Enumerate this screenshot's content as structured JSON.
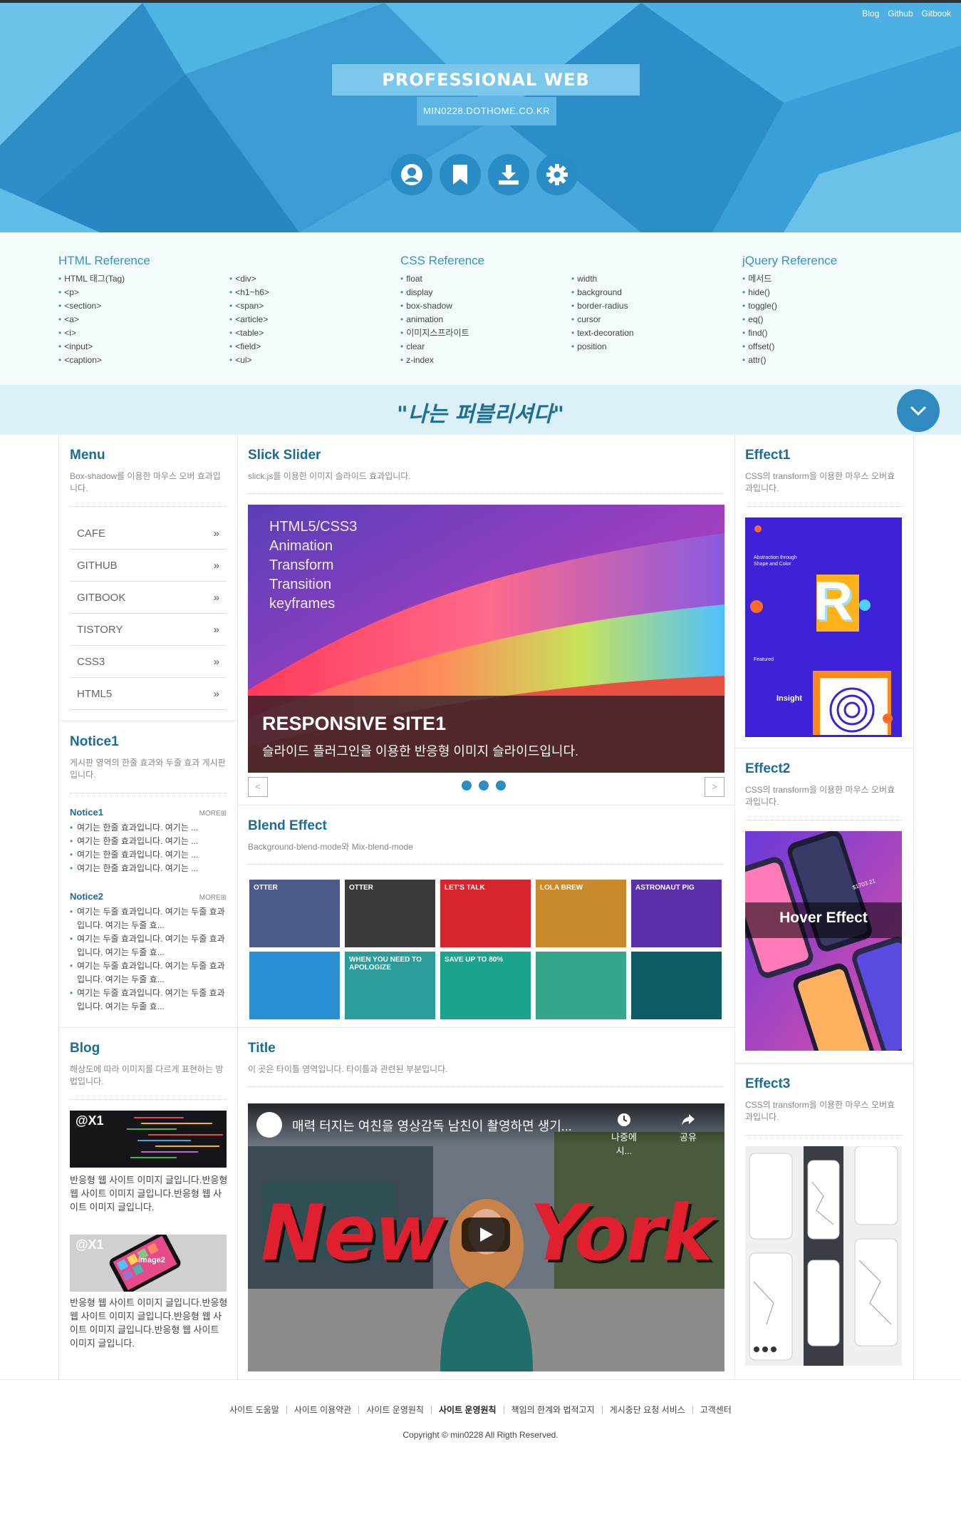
{
  "header": {
    "toplinks": [
      "Blog",
      "Github",
      "Gitbook"
    ],
    "title": "PROFESSIONAL WEB PUBLISHER",
    "subtitle": "MIN0228.DOTHOME.CO.KR",
    "icons": [
      "user-icon",
      "bookmark-icon",
      "download-icon",
      "gear-icon"
    ]
  },
  "refs": {
    "html": {
      "title": "HTML Reference",
      "col1": [
        "HTML 태그(Tag)",
        "<p>",
        "<section>",
        "<a>",
        "<i>",
        "<input>",
        "<caption>"
      ],
      "col2": [
        "<div>",
        "<h1~h6>",
        "<span>",
        "<article>",
        "<table>",
        "<field>",
        "<ul>"
      ]
    },
    "css": {
      "title": "CSS Reference",
      "col1": [
        "float",
        "display",
        "box-shadow",
        "animation",
        "이미지스프라이트",
        "clear",
        "z-index"
      ],
      "col2": [
        "width",
        "background",
        "border-radius",
        "cursor",
        "text-decoration",
        "position"
      ]
    },
    "jquery": {
      "title": "jQuery Reference",
      "col1": [
        "메서드",
        "hide()",
        "toggle()",
        "eq()",
        "find()",
        "offset()",
        "attr()"
      ]
    }
  },
  "banner": {
    "text": "\"나는 퍼블리셔다\""
  },
  "menu": {
    "title": "Menu",
    "desc": "Box-shadow를 이용한 마우스 오버 효과입니다.",
    "items": [
      "CAFE",
      "GITHUB",
      "GITBOOK",
      "TISTORY",
      "CSS3",
      "HTML5"
    ],
    "arrow": "»"
  },
  "notice": {
    "title": "Notice1",
    "desc": "게시판 영역의 한줄 효과와 두줄 효과 게시판 입니다.",
    "n1_title": "Notice1",
    "n1_more": "MORE⊞",
    "n1_items": [
      "여기는 한줄 효과입니다. 여기는 ...",
      "여기는 한줄 효과입니다. 여기는 ...",
      "여기는 한줄 효과입니다. 여기는 ...",
      "여기는 한줄 효과입니다. 여기는 ..."
    ],
    "n2_title": "Notice2",
    "n2_more": "MORE⊞",
    "n2_items": [
      "여기는 두줄 효과입니다. 여기는 두줄 효과입니다. 여기는 두줄 효...",
      "여기는 두줄 효과입니다. 여기는 두줄 효과입니다. 여기는 두줄 효...",
      "여기는 두줄 효과입니다. 여기는 두줄 효과입니다. 여기는 두줄 효...",
      "여기는 두줄 효과입니다. 여기는 두줄 효과입니다. 여기는 두줄 효..."
    ]
  },
  "blog": {
    "title": "Blog",
    "desc": "해상도에 따라 이미지를 다르게 표현하는 방법입니다.",
    "img1": "@X1",
    "img2": "@X1",
    "img2_label": "image2",
    "text1": "반응형 웹 사이트 이미지 글입니다.반응형 웹 사이트 이미지 글입니다.반응형 웹 사이트 이미지 글입니다.",
    "text2": "반응형 웹 사이트 이미지 글입니다.반응형 웹 사이트 이미지 글입니다.반응형 웹 사이트 이미지 글입니다.반응형 웹 사이트 이미지 글입니다."
  },
  "slick": {
    "title": "Slick Slider",
    "desc": "slick.js를 이용한 이미지 슬라이드 효과입니다.",
    "lines": [
      "HTML5/CSS3",
      "Animation",
      "Transform",
      "Transition",
      "keyframes"
    ],
    "caption_title": "RESPONSIVE SITE1",
    "caption_text": "슬라이드 플러그인을 이용한 반응형 이미지 슬라이드입니다.",
    "prev": "<",
    "next": ">",
    "slide_count": 3
  },
  "blend": {
    "title": "Blend Effect",
    "desc": "Background-blend-mode와 Mix-blend-mode",
    "tiles": [
      {
        "label": "OTTER",
        "color": "#4c5a8a"
      },
      {
        "label": "OTTER",
        "color": "#3f3a3a"
      },
      {
        "label": "LET'S TALK",
        "color": "#d6252d"
      },
      {
        "label": "LOLA BREW",
        "color": "#c98a2c"
      },
      {
        "label": "ASTRONAUT PIG",
        "color": "#5b2fa8"
      },
      {
        "label": "",
        "color": "#2b8fd6"
      },
      {
        "label": "WHEN YOU NEED TO APOLOGIZE",
        "color": "#2a9c9a"
      },
      {
        "label": "SAVE UP TO 80%",
        "color": "#1aa38d"
      },
      {
        "label": "",
        "color": "#36a78b"
      },
      {
        "label": "",
        "color": "#0e5c63"
      }
    ]
  },
  "titlesec": {
    "title": "Title",
    "desc": "이 곳은 타이틀 영역입니다. 타이틀과 관련된 부분입니다."
  },
  "video": {
    "title": "매력 터지는 여친을 영상감독 남친이 촬영하면 생기...",
    "later": "나중에 시...",
    "share": "공유",
    "big_left": "New",
    "big_right": "York"
  },
  "effect1": {
    "title": "Effect1",
    "desc": "CSS의 transform을 이용한 마우스 오버효과입니다.",
    "img_text": "Abstraction through Shape and Color",
    "letter": "R",
    "featured": "Featured",
    "insight": "Insight"
  },
  "effect2": {
    "title": "Effect2",
    "desc": "CSS의 transform을 이용한 마우스 오버효과입니다.",
    "overlay": "Hover Effect",
    "amount": "$1703.21"
  },
  "effect3": {
    "title": "Effect3",
    "desc": "CSS의 transform을 이용한 마우스 오버효과입니다."
  },
  "footer": {
    "links": [
      "사이트 도움말",
      "사이트 이용약관",
      "사이트 운영원칙",
      "사이트 운영원칙",
      "책임의 한계와 법적고지",
      "게시중단 요청 서비스",
      "고객센터"
    ],
    "copyright": "Copyright © min0228 All Rigth Reserved."
  },
  "colors": {
    "accent": "#2f8bc0",
    "header_bg": "#3aa3d8",
    "title_blue": "#1b6c98"
  }
}
